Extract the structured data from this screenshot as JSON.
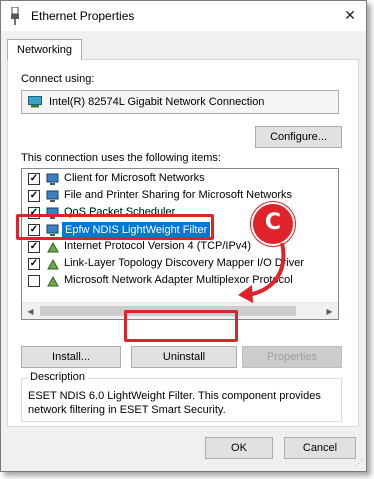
{
  "window": {
    "title": "Ethernet Properties",
    "close_glyph": "✕"
  },
  "tabs": [
    {
      "label": "Networking"
    }
  ],
  "connect_using": {
    "label": "Connect using:",
    "adapter": "Intel(R) 82574L Gigabit Network Connection",
    "configure_label": "Configure..."
  },
  "items_label": "This connection uses the following items:",
  "items": [
    {
      "label": "Client for Microsoft Networks",
      "checked": true,
      "icon": "network-client-icon"
    },
    {
      "label": "File and Printer Sharing for Microsoft Networks",
      "checked": true,
      "icon": "network-service-icon"
    },
    {
      "label": "QoS Packet Scheduler",
      "checked": true,
      "icon": "network-service-icon"
    },
    {
      "label": "Epfw NDIS LightWeight Filter",
      "checked": true,
      "selected": true,
      "icon": "network-filter-icon"
    },
    {
      "label": "Internet Protocol Version 4 (TCP/IPv4)",
      "checked": true,
      "icon": "protocol-icon"
    },
    {
      "label": "Link-Layer Topology Discovery Mapper I/O Driver",
      "checked": true,
      "icon": "protocol-icon"
    },
    {
      "label": "Microsoft Network Adapter Multiplexor Protocol",
      "checked": false,
      "icon": "protocol-icon"
    }
  ],
  "buttons": {
    "install": "Install...",
    "uninstall": "Uninstall",
    "properties": "Properties",
    "ok": "OK",
    "cancel": "Cancel"
  },
  "description": {
    "legend": "Description",
    "text": "ESET NDIS 6.0 LightWeight Filter. This component provides network filtering in ESET Smart Security."
  },
  "annotation": {
    "callout_letter": "C",
    "color": "#e0222a"
  },
  "colors": {
    "selection": "#0078d7",
    "accent": "#0078d7"
  }
}
